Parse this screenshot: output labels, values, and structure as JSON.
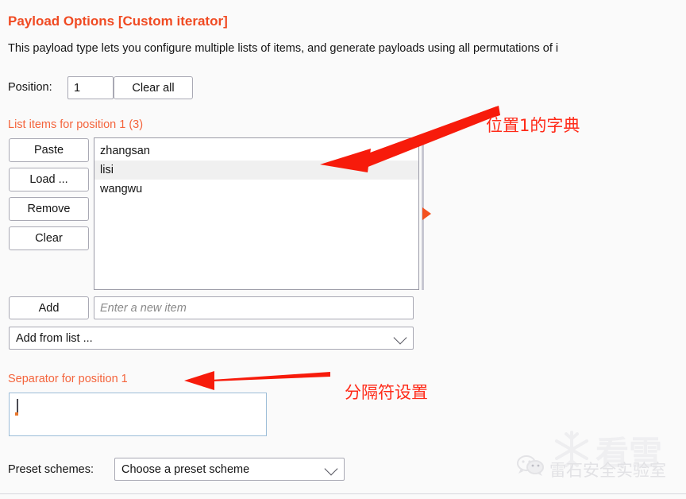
{
  "panel": {
    "title": "Payload Options [Custom iterator]",
    "description": "This payload type lets you configure multiple lists of items, and generate payloads using all permutations of i"
  },
  "position_row": {
    "label": "Position:",
    "value": "1",
    "clear_all_label": "Clear all"
  },
  "list_section": {
    "heading": "List items for position 1 (3)",
    "buttons": [
      {
        "label": "Paste"
      },
      {
        "label": "Load ..."
      },
      {
        "label": "Remove"
      },
      {
        "label": "Clear"
      }
    ],
    "items": [
      {
        "text": "zhangsan",
        "selected": false
      },
      {
        "text": "lisi",
        "selected": true
      },
      {
        "text": "wangwu",
        "selected": false
      }
    ]
  },
  "add_row": {
    "add_label": "Add",
    "new_item_placeholder": "Enter a new item",
    "new_item_value": "",
    "add_from_list_label": "Add from list ..."
  },
  "separator_section": {
    "heading": "Separator for position 1",
    "value": ","
  },
  "preset_row": {
    "label": "Preset schemes:",
    "selected": "Choose a preset scheme"
  },
  "annotations": [
    {
      "text": "位置1的字典"
    },
    {
      "text": "分隔符设置"
    }
  ],
  "watermark": {
    "account": "雷石安全实验室",
    "backdrop": "看雪"
  },
  "colors": {
    "accent": "#f04a22",
    "sub_accent": "#f4643c",
    "annotation_red": "#ff2a18",
    "marker_orange": "#f4511e",
    "selection_gray": "#f0f0f0",
    "focus_border": "#9cbdd8",
    "page_background": "#fafafa"
  }
}
